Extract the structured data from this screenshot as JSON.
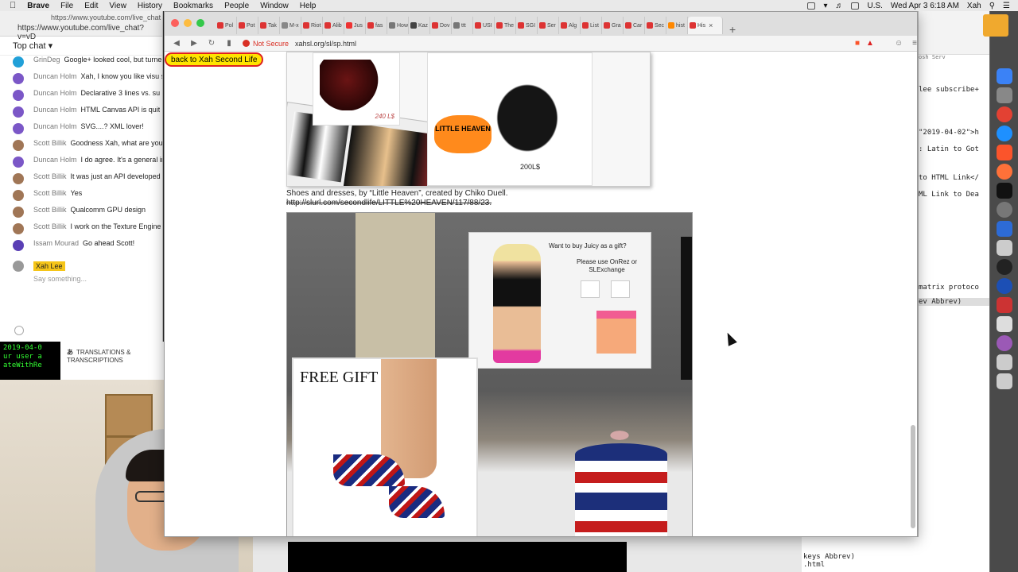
{
  "menubar": {
    "app": "Brave",
    "items": [
      "File",
      "Edit",
      "View",
      "History",
      "Bookmarks",
      "People",
      "Window",
      "Help"
    ],
    "locale": "U.S.",
    "clock": "Wed Apr 3  6:18 AM",
    "user": "Xah"
  },
  "chat": {
    "url_top": "https://www.youtube.com/live_chat",
    "url": "https://www.youtube.com/live_chat?v=vD",
    "header": "Top chat",
    "messages": [
      {
        "name": "GrinDeg",
        "text": "Google+ looked cool, but turne"
      },
      {
        "name": "Duncan Holm",
        "text": "Xah, I know you like visu seem to have gotten into WebGL with J"
      },
      {
        "name": "Duncan Holm",
        "text": "Declarative 3 lines vs. su"
      },
      {
        "name": "Duncan Holm",
        "text": "HTML Canvas API is quit"
      },
      {
        "name": "Duncan Holm",
        "text": "SVG....? XML lover!"
      },
      {
        "name": "Scott Billik",
        "text": "Goodness Xah, what are you and watch the recording, what were tod"
      },
      {
        "name": "Duncan Holm",
        "text": "I do agree. It's a general imperative when they could instead be d"
      },
      {
        "name": "Scott Billik",
        "text": "It was just an API developed they evolved it."
      },
      {
        "name": "Scott Billik",
        "text": "Yes"
      },
      {
        "name": "Scott Billik",
        "text": "Qualcomm GPU design"
      },
      {
        "name": "Scott Billik",
        "text": "I work on the Texture Engine"
      },
      {
        "name": "Issam Mourad",
        "text": "Go ahead Scott!"
      }
    ],
    "my_name": "Xah Lee",
    "say_placeholder": "Say something..."
  },
  "terminal": {
    "lines": [
      "2019-04-0",
      "ur user a",
      "ateWithRe"
    ]
  },
  "translations": {
    "label": "TRANSLATIONS & TRANSCRIPTIONS"
  },
  "browser": {
    "tabs": [
      "Pol",
      "Pot",
      "Tak",
      "M-x",
      "Riot",
      "Alib",
      "Jus",
      "fas",
      "How",
      "Kaz",
      "Dov",
      "ttt",
      "USI",
      "The",
      "SGI",
      "Ser",
      "Alg",
      "List",
      "Gra",
      "Car",
      "Sec",
      "hist",
      "His"
    ],
    "security": "Not Secure",
    "url": "xahsl.org/sl/sp.html",
    "back_link": "back to Xah Second Life",
    "image1": {
      "price1": "240 L$",
      "logo": "LITTLE HEAVEN",
      "price2": "200L$"
    },
    "caption": "Shoes and dresses, by “Little Heaven”, created by Chiko Duell.",
    "caption_link": "http://slurl.com/secondlife/LITTLE%20HEAVEN/117/88/23.",
    "image2": {
      "poster_title": "Want to buy Juicy as a gift?",
      "poster_text": "Please use OnRez or SLExchange",
      "free_gift": "FREE GIFT"
    }
  },
  "editor": {
    "lines": [
      "lee subscribe+",
      "\"2019-04-02\">h",
      ": Latin to Got",
      "to HTML Link</",
      "ML Link to Dea",
      "matrix protoco",
      "ev Abbrev)"
    ],
    "header": "osh Serv",
    "bottom_lines": [
      "keys Abbrev)",
      ".html"
    ]
  },
  "colors": {
    "back_link_bg": "#ffe400",
    "not_secure": "#d93025",
    "dock_bg": "#4a4a4a"
  }
}
